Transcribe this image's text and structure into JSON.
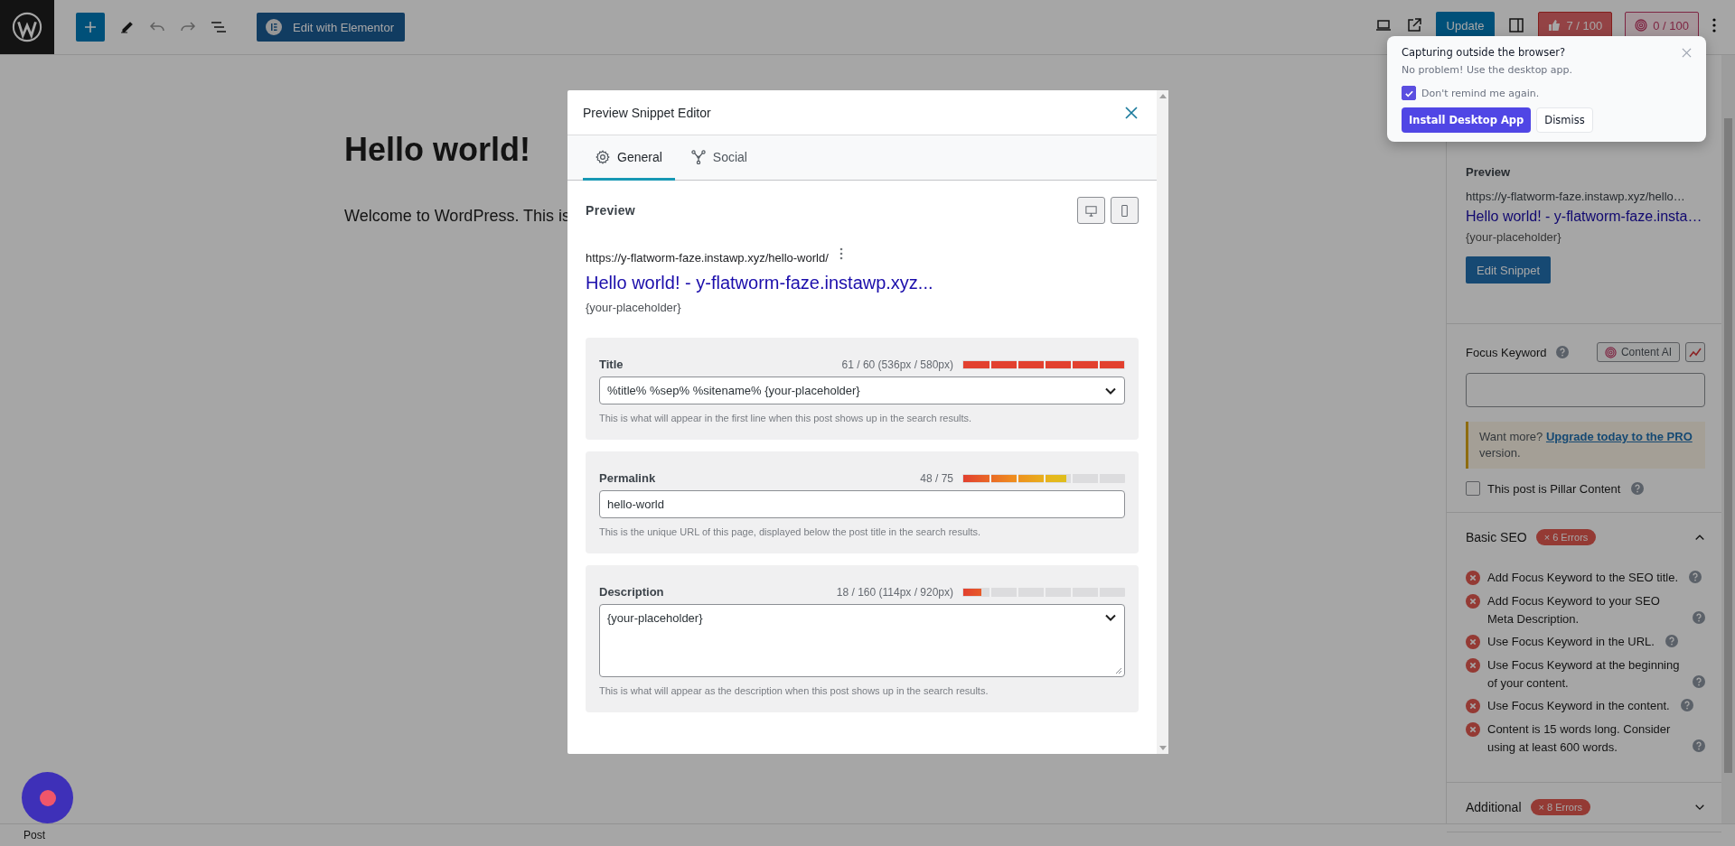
{
  "toolbar": {
    "elementor_button": "Edit with Elementor",
    "update_button": "Update",
    "scores": [
      {
        "kind": "seo",
        "label": "7 / 100"
      },
      {
        "kind": "content-ai",
        "label": "0 / 100"
      }
    ]
  },
  "editor": {
    "heading": "Hello world!",
    "paragraph": "Welcome to WordPress. This is"
  },
  "sidebar": {
    "preview": {
      "heading": "Preview",
      "url": "https://y-flatworm-faze.instawp.xyz/hello…",
      "title": "Hello world! - y-flatworm-faze.insta…",
      "description": "{your-placeholder}",
      "button": "Edit Snippet"
    },
    "focus_keyword": {
      "label": "Focus Keyword",
      "content_ai_button": "Content AI"
    },
    "notice": {
      "before": "Want more?",
      "link": "Upgrade today to the PRO",
      "after": "version."
    },
    "pillar": {
      "label": "This post is Pillar Content",
      "checked": false
    },
    "sections": [
      {
        "title": "Basic SEO",
        "badge": "× 6 Errors",
        "expanded": true,
        "items": [
          "Add Focus Keyword to the SEO title.",
          "Add Focus Keyword to your SEO Meta Description.",
          "Use Focus Keyword in the URL.",
          "Use Focus Keyword at the beginning of your content.",
          "Use Focus Keyword in the content.",
          "Content is 15 words long. Consider using at least 600 words."
        ]
      },
      {
        "title": "Additional",
        "badge": "× 8 Errors",
        "expanded": false
      }
    ]
  },
  "status_bar": {
    "label": "Post"
  },
  "modal": {
    "title": "Preview Snippet Editor",
    "tabs": [
      {
        "kind": "general",
        "label": "General",
        "selected": true
      },
      {
        "kind": "social",
        "label": "Social",
        "selected": false
      }
    ],
    "preview": {
      "heading": "Preview",
      "url": "https://y-flatworm-faze.instawp.xyz/hello-world/",
      "title": "Hello world! - y-flatworm-faze.instawp.xyz...",
      "description": "{your-placeholder}"
    },
    "fields": [
      {
        "kind": "select",
        "label": "Title",
        "counter": "61 / 60 (536px / 580px)",
        "level": 1,
        "value": "%title% %sep% %sitename% {your-placeholder}",
        "help": "This is what will appear in the first line when this post shows up in the search results."
      },
      {
        "kind": "input",
        "label": "Permalink",
        "counter": "48 / 75",
        "level": 0.64,
        "value": "hello-world",
        "help": "This is the unique URL of this page, displayed below the post title in the search results."
      },
      {
        "kind": "textarea",
        "label": "Description",
        "counter": "18 / 160 (114px / 920px)",
        "level": 0.11,
        "value": "{your-placeholder}",
        "help": "This is what will appear as the description when this post shows up in the search results."
      }
    ]
  },
  "popup": {
    "title": "Capturing outside the browser?",
    "text": "No problem! Use the desktop app.",
    "checkbox": {
      "label": "Don't remind me again.",
      "checked": true
    },
    "primary_button": "Install Desktop App",
    "secondary_button": "Dismiss"
  }
}
